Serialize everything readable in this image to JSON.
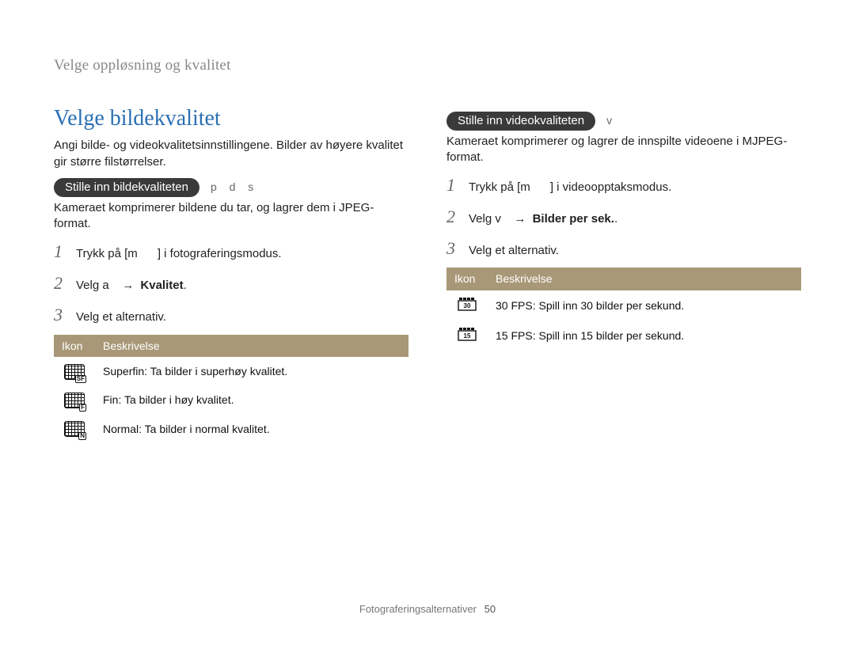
{
  "breadcrumb": "Velge oppløsning og kvalitet",
  "left": {
    "title": "Velge bildekvalitet",
    "intro": "Angi bilde- og videokvalitetsinnstillingene. Bilder av høyere kvalitet gir større filstørrelser.",
    "sub_pill": "Stille inn bildekvaliteten",
    "modes": "p   d   s",
    "sub_intro": "Kameraet komprimerer bildene du tar, og lagrer dem i JPEG-format.",
    "steps": {
      "s1_a": "Trykk på [",
      "s1_b": "m",
      "s1_c": "] i fotograferingsmodus.",
      "s2_a": "Velg ",
      "s2_b": "a",
      "s2_arrow": "→",
      "s2_bold": "Kvalitet",
      "s2_dot": ".",
      "s3": "Velg et alternativ."
    },
    "table": {
      "h_icon": "Ikon",
      "h_desc": "Beskrivelse",
      "rows": [
        {
          "icon_sub": "SF",
          "name": "Superfin",
          "desc": ": Ta bilder i superhøy kvalitet."
        },
        {
          "icon_sub": "F",
          "name": "Fin",
          "desc": ": Ta bilder i høy kvalitet."
        },
        {
          "icon_sub": "N",
          "name": "Normal",
          "desc": ": Ta bilder i normal kvalitet."
        }
      ]
    }
  },
  "right": {
    "sub_pill": "Stille inn videokvaliteten",
    "modes": "v",
    "sub_intro": "Kameraet komprimerer og lagrer de innspilte videoene i MJPEG-format.",
    "steps": {
      "s1_a": "Trykk på [",
      "s1_b": "m",
      "s1_c": "] i videoopptaksmodus.",
      "s2_a": "Velg ",
      "s2_b": "v",
      "s2_arrow": "→",
      "s2_bold": "Bilder per sek.",
      "s2_dot": ".",
      "s3": "Velg et alternativ."
    },
    "table": {
      "h_icon": "Ikon",
      "h_desc": "Beskrivelse",
      "rows": [
        {
          "icon_sub": "30",
          "name": "30 FPS",
          "desc": ": Spill inn 30 bilder per sekund."
        },
        {
          "icon_sub": "15",
          "name": "15 FPS",
          "desc": ": Spill inn 15 bilder per sekund."
        }
      ]
    }
  },
  "footer": {
    "section": "Fotograferingsalternativer",
    "page": "50"
  }
}
